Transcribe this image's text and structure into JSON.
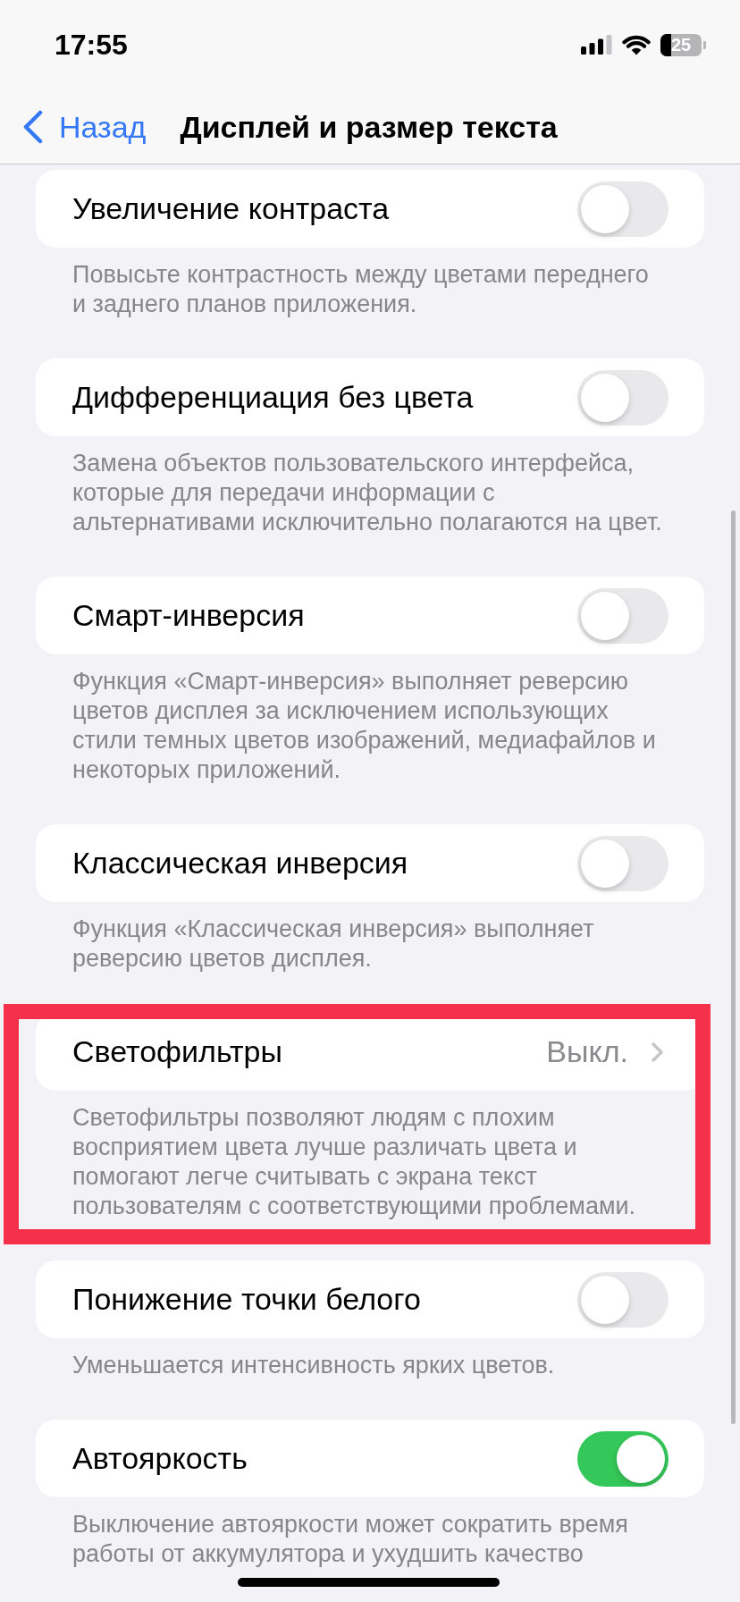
{
  "status_bar": {
    "time": "17:55",
    "battery": "25"
  },
  "nav": {
    "back": "Назад",
    "title": "Дисплей и размер текста"
  },
  "sections": [
    {
      "kind": "toggle",
      "label": "Увеличение контраста",
      "on": false,
      "highlighted": false,
      "footer": "Повысьте контрастность между цветами переднего и заднего планов приложения."
    },
    {
      "kind": "toggle",
      "label": "Дифференциация без цвета",
      "on": false,
      "highlighted": false,
      "footer": "Замена объектов пользовательского интерфейса, которые для передачи информации с альтернативами исключительно полагаются на цвет."
    },
    {
      "kind": "toggle",
      "label": "Смарт-инверсия",
      "on": false,
      "highlighted": false,
      "footer": "Функция «Смарт-инверсия» выполняет реверсию цветов дисплея за исключением использующих стили темных цветов изображений, медиафайлов и некоторых приложений."
    },
    {
      "kind": "toggle",
      "label": "Классическая инверсия",
      "on": false,
      "highlighted": false,
      "footer": "Функция «Классическая инверсия» выполняет реверсию цветов дисплея."
    },
    {
      "kind": "link",
      "label": "Светофильтры",
      "value": "Выкл.",
      "highlighted": true,
      "footer": "Светофильтры позволяют людям с плохим восприятием цвета лучше различать цвета и помогают легче считывать с экрана текст пользователям с соответствующими проблемами."
    },
    {
      "kind": "toggle",
      "label": "Понижение точки белого",
      "on": false,
      "highlighted": false,
      "footer": "Уменьшается интенсивность ярких цветов."
    },
    {
      "kind": "toggle",
      "label": "Автояркость",
      "on": true,
      "highlighted": false,
      "footer": "Выключение автояркости может сократить время работы от аккумулятора и ухудшить качество"
    }
  ]
}
